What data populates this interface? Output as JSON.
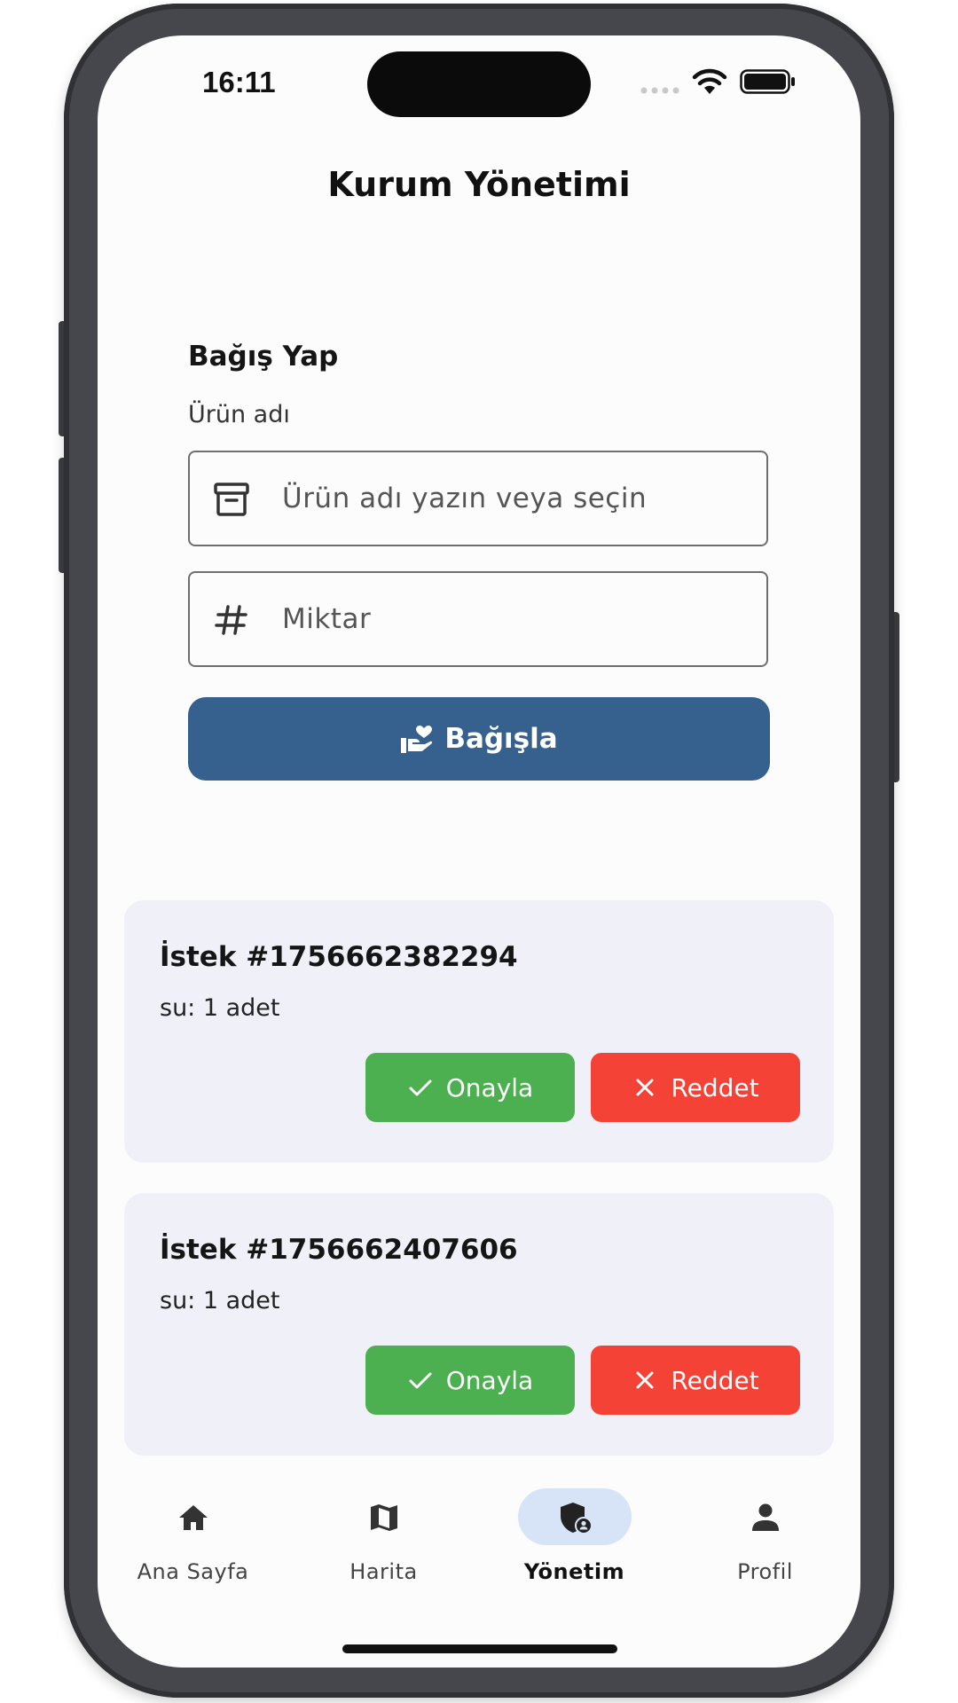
{
  "status_bar": {
    "time": "16:11"
  },
  "header": {
    "title": "Kurum Yönetimi"
  },
  "donation_form": {
    "heading": "Bağış Yap",
    "product_label": "Ürün adı",
    "product_placeholder": "Ürün adı yazın veya seçin",
    "quantity_placeholder": "Miktar",
    "submit_label": "Bağışla"
  },
  "requests": [
    {
      "title": "İstek #1756662382294",
      "detail": "su: 1 adet",
      "approve_label": "Onayla",
      "reject_label": "Reddet"
    },
    {
      "title": "İstek #1756662407606",
      "detail": "su: 1 adet",
      "approve_label": "Onayla",
      "reject_label": "Reddet"
    }
  ],
  "nav": {
    "items": [
      {
        "label": "Ana Sayfa",
        "icon": "home-icon"
      },
      {
        "label": "Harita",
        "icon": "map-icon"
      },
      {
        "label": "Yönetim",
        "icon": "admin-shield-icon",
        "active": true
      },
      {
        "label": "Profil",
        "icon": "person-icon"
      }
    ]
  },
  "colors": {
    "primary": "#36618e",
    "approve": "#4caf50",
    "reject": "#f44336",
    "card_background": "#f0f1f8",
    "nav_active_pill": "#d7e3f7"
  }
}
